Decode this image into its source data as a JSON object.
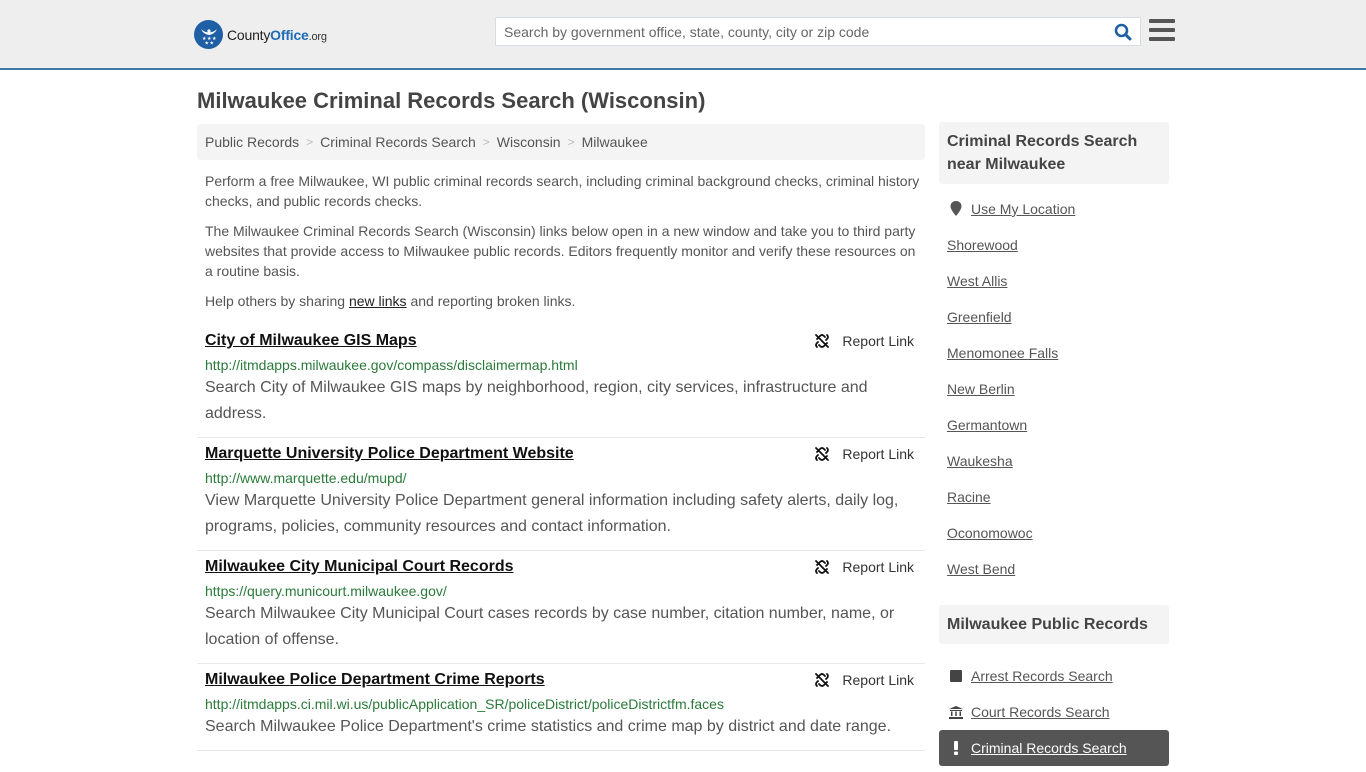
{
  "header": {
    "logo": {
      "part1": "County",
      "part2": "Office",
      "part3": ".org"
    },
    "search": {
      "placeholder": "Search by government office, state, county, city or zip code",
      "value": ""
    },
    "colors": {
      "brand": "#1e6bb8",
      "header_bg": "#eeeeee",
      "header_border": "#3e77a8"
    }
  },
  "page": {
    "title": "Milwaukee Criminal Records Search (Wisconsin)",
    "breadcrumb": [
      "Public Records",
      "Criminal Records Search",
      "Wisconsin",
      "Milwaukee"
    ],
    "breadcrumb_separator": ">",
    "intro": {
      "p1": "Perform a free Milwaukee, WI public criminal records search, including criminal background checks, criminal history checks, and public records checks.",
      "p2": "The Milwaukee Criminal Records Search (Wisconsin) links below open in a new window and take you to third party websites that provide access to Milwaukee public records. Editors frequently monitor and verify these resources on a routine basis.",
      "p3_before": "Help others by sharing ",
      "p3_link": "new links",
      "p3_after": " and reporting broken links."
    }
  },
  "results": [
    {
      "title": "City of Milwaukee GIS Maps",
      "url": "http://itmdapps.milwaukee.gov/compass/disclaimermap.html",
      "description": "Search City of Milwaukee GIS maps by neighborhood, region, city services, infrastructure and address.",
      "report_label": "Report Link"
    },
    {
      "title": "Marquette University Police Department Website",
      "url": "http://www.marquette.edu/mupd/",
      "description": "View Marquette University Police Department general information including safety alerts, daily log, programs, policies, community resources and contact information.",
      "report_label": "Report Link"
    },
    {
      "title": "Milwaukee City Municipal Court Records",
      "url": "https://query.municourt.milwaukee.gov/",
      "description": "Search Milwaukee City Municipal Court cases records by case number, citation number, name, or location of offense.",
      "report_label": "Report Link"
    },
    {
      "title": "Milwaukee Police Department Crime Reports",
      "url": "http://itmdapps.ci.mil.wi.us/publicApplication_SR/policeDistrict/policeDistrictfm.faces",
      "description": "Search Milwaukee Police Department's crime statistics and crime map by district and date range.",
      "report_label": "Report Link"
    }
  ],
  "sidebar": {
    "nearby": {
      "heading": "Criminal Records Search near Milwaukee",
      "use_location": "Use My Location",
      "cities": [
        "Shorewood",
        "West Allis",
        "Greenfield",
        "Menomonee Falls",
        "New Berlin",
        "Germantown",
        "Waukesha",
        "Racine",
        "Oconomowoc",
        "West Bend"
      ]
    },
    "public_records": {
      "heading": "Milwaukee Public Records",
      "items": [
        {
          "label": "Arrest Records Search",
          "icon": "square-icon",
          "active": false
        },
        {
          "label": "Court Records Search",
          "icon": "courthouse-icon",
          "active": false
        },
        {
          "label": "Criminal Records Search",
          "icon": "exclamation-icon",
          "active": true
        }
      ]
    }
  }
}
